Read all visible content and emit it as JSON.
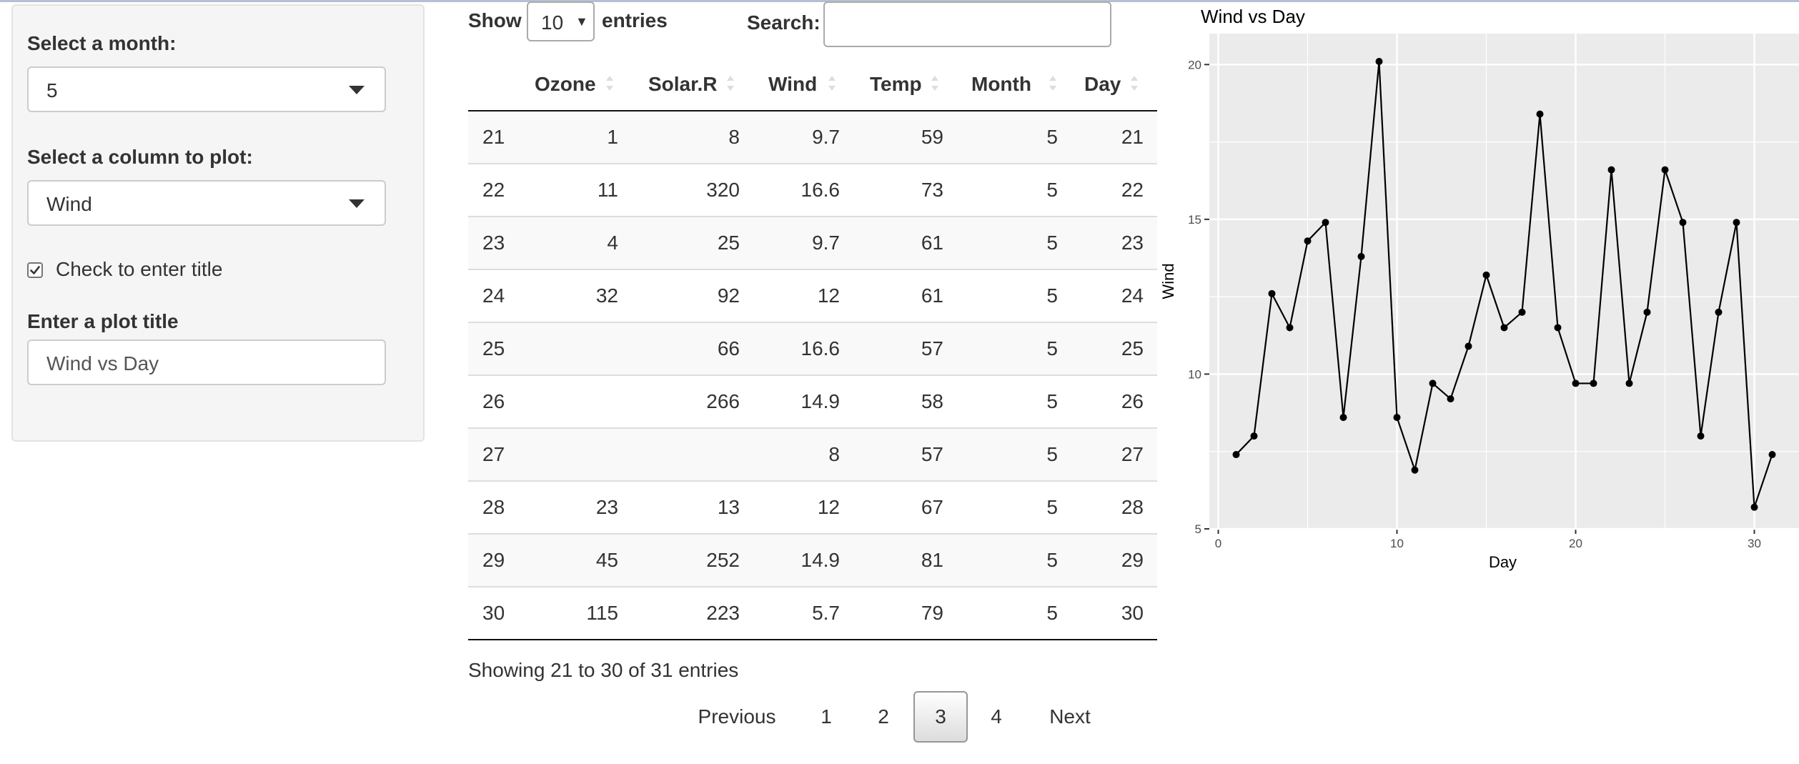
{
  "sidebar": {
    "month_label": "Select a month:",
    "month_value": "5",
    "column_label": "Select a column to plot:",
    "column_value": "Wind",
    "checkbox_label": "Check to enter title",
    "checkbox_checked": true,
    "title_label": "Enter a plot title",
    "title_value": "Wind vs Day"
  },
  "table_controls": {
    "show_label": "Show",
    "length_value": "10",
    "entries_label": "entries",
    "search_label": "Search:",
    "search_value": ""
  },
  "table": {
    "columns": [
      "",
      "Ozone",
      "Solar.R",
      "Wind",
      "Temp",
      "Month",
      "Day"
    ],
    "rows": [
      [
        "21",
        "1",
        "8",
        "9.7",
        "59",
        "5",
        "21"
      ],
      [
        "22",
        "11",
        "320",
        "16.6",
        "73",
        "5",
        "22"
      ],
      [
        "23",
        "4",
        "25",
        "9.7",
        "61",
        "5",
        "23"
      ],
      [
        "24",
        "32",
        "92",
        "12",
        "61",
        "5",
        "24"
      ],
      [
        "25",
        "",
        "66",
        "16.6",
        "57",
        "5",
        "25"
      ],
      [
        "26",
        "",
        "266",
        "14.9",
        "58",
        "5",
        "26"
      ],
      [
        "27",
        "",
        "",
        "8",
        "57",
        "5",
        "27"
      ],
      [
        "28",
        "23",
        "13",
        "12",
        "67",
        "5",
        "28"
      ],
      [
        "29",
        "45",
        "252",
        "14.9",
        "81",
        "5",
        "29"
      ],
      [
        "30",
        "115",
        "223",
        "5.7",
        "79",
        "5",
        "30"
      ]
    ],
    "info": "Showing 21 to 30 of 31 entries"
  },
  "pagination": {
    "previous": "Previous",
    "pages": [
      "1",
      "2",
      "3",
      "4"
    ],
    "current": "3",
    "next": "Next"
  },
  "chart_data": {
    "type": "line",
    "title": "Wind vs Day",
    "xlabel": "Day",
    "ylabel": "Wind",
    "x": [
      1,
      2,
      3,
      4,
      5,
      6,
      7,
      8,
      9,
      10,
      11,
      12,
      13,
      14,
      15,
      16,
      17,
      18,
      19,
      20,
      21,
      22,
      23,
      24,
      25,
      26,
      27,
      28,
      29,
      30,
      31
    ],
    "y": [
      7.4,
      8,
      12.6,
      11.5,
      14.3,
      14.9,
      8.6,
      13.8,
      20.1,
      8.6,
      6.9,
      9.7,
      9.2,
      10.9,
      13.2,
      11.5,
      12,
      18.4,
      11.5,
      9.7,
      9.7,
      16.6,
      9.7,
      12,
      16.6,
      14.9,
      8,
      12,
      14.9,
      5.7,
      7.4
    ],
    "xlim": [
      -0.5,
      32.5
    ],
    "ylim": [
      5,
      21
    ],
    "xticks": [
      0,
      10,
      20,
      30
    ],
    "yticks": [
      5,
      10,
      15,
      20
    ],
    "grid": true,
    "markers": true,
    "panel_color": "#ebebeb",
    "line_color": "#000000"
  }
}
